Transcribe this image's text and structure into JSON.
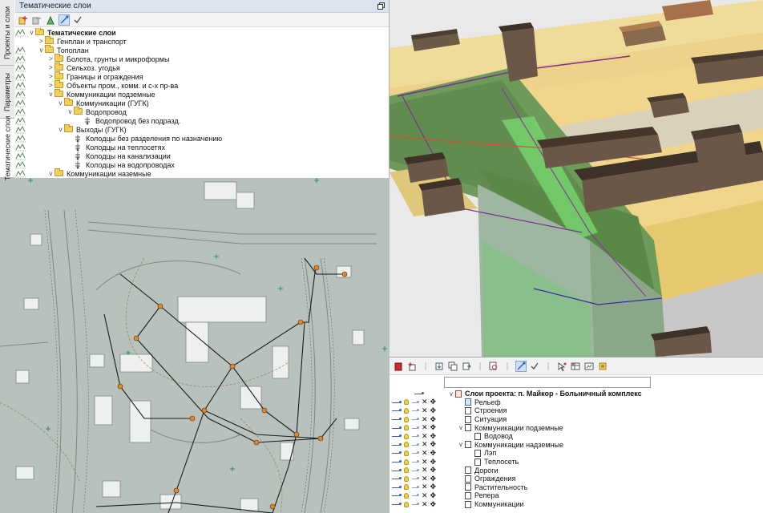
{
  "thematic_panel": {
    "title": "Тематические слои",
    "side_tabs": [
      "Проекты и слои",
      "Параметры",
      "Тематические слои"
    ],
    "tree": [
      {
        "label": "Тематические слои",
        "depth": 0,
        "expander": "v",
        "bold": true,
        "icon": "folder-icon",
        "marks": true
      },
      {
        "label": "Генплан и транспорт",
        "depth": 1,
        "expander": ">",
        "icon": "folder-icon",
        "marks": false
      },
      {
        "label": "Топоплан",
        "depth": 1,
        "expander": "v",
        "icon": "folder-icon",
        "marks": true
      },
      {
        "label": "Болота, грунты и микроформы",
        "depth": 2,
        "expander": ">",
        "icon": "folder-icon",
        "marks": true
      },
      {
        "label": "Сельхоз. угодья",
        "depth": 2,
        "expander": ">",
        "icon": "folder-icon",
        "marks": true
      },
      {
        "label": "Границы и ограждения",
        "depth": 2,
        "expander": ">",
        "icon": "folder-icon",
        "marks": true
      },
      {
        "label": "Объекты пром., комм. и с-х пр-ва",
        "depth": 2,
        "expander": ">",
        "icon": "folder-icon",
        "marks": true
      },
      {
        "label": "Коммуникации подземные",
        "depth": 2,
        "expander": "v",
        "icon": "folder-icon",
        "marks": true
      },
      {
        "label": "Коммуникации (ГУГК)",
        "depth": 3,
        "expander": "v",
        "icon": "folder-icon",
        "marks": true
      },
      {
        "label": "Водопровод",
        "depth": 4,
        "expander": "v",
        "icon": "folder-icon",
        "marks": true
      },
      {
        "label": "Водопровод без подразд.",
        "depth": 5,
        "expander": "",
        "icon": "layer-icon",
        "marks": true
      },
      {
        "label": "Выходы (ГУГК)",
        "depth": 3,
        "expander": "v",
        "icon": "folder-icon",
        "marks": true
      },
      {
        "label": "Колодцы без разделения по назначению",
        "depth": 4,
        "expander": "",
        "icon": "layer-icon",
        "marks": true
      },
      {
        "label": "Колодцы на теплосетях",
        "depth": 4,
        "expander": "",
        "icon": "layer-icon",
        "marks": true
      },
      {
        "label": "Колодцы  на канализации",
        "depth": 4,
        "expander": "",
        "icon": "layer-icon",
        "marks": true
      },
      {
        "label": "Колодцы на водопроводах",
        "depth": 4,
        "expander": "",
        "icon": "layer-icon",
        "marks": true
      },
      {
        "label": "Коммуникации наземные",
        "depth": 2,
        "expander": "v",
        "icon": "folder-icon",
        "marks": true
      }
    ]
  },
  "project_panel": {
    "search_value": "",
    "tree": [
      {
        "label": "Слои проекта: п. Майкор - Больничный комплекс",
        "depth": 0,
        "expander": "v",
        "bold": true,
        "icon": "proj",
        "controls": false
      },
      {
        "label": "Рельеф",
        "depth": 1,
        "expander": "",
        "icon": "blue",
        "controls": true
      },
      {
        "label": "Строения",
        "depth": 1,
        "expander": "",
        "icon": "doc",
        "controls": true
      },
      {
        "label": "Ситуация",
        "depth": 1,
        "expander": "",
        "icon": "doc",
        "controls": true
      },
      {
        "label": "Коммуникации подземные",
        "depth": 1,
        "expander": "v",
        "icon": "doc",
        "controls": true
      },
      {
        "label": "Водовод",
        "depth": 2,
        "expander": "",
        "icon": "doc",
        "controls": true
      },
      {
        "label": "Коммуникации надземные",
        "depth": 1,
        "expander": "v",
        "icon": "doc",
        "controls": true
      },
      {
        "label": "Лэп",
        "depth": 2,
        "expander": "",
        "icon": "doc",
        "controls": true
      },
      {
        "label": "Теплосеть",
        "depth": 2,
        "expander": "",
        "icon": "doc",
        "controls": true
      },
      {
        "label": "Дороги",
        "depth": 1,
        "expander": "",
        "icon": "doc",
        "controls": true
      },
      {
        "label": "Ограждения",
        "depth": 1,
        "expander": "",
        "icon": "doc",
        "controls": true
      },
      {
        "label": "Растительность",
        "depth": 1,
        "expander": "",
        "icon": "doc",
        "controls": true
      },
      {
        "label": "Репера",
        "depth": 1,
        "expander": "",
        "icon": "doc",
        "controls": true
      },
      {
        "label": "Коммуникации",
        "depth": 1,
        "expander": "",
        "icon": "doc",
        "controls": true
      }
    ]
  },
  "colors": {
    "terrain_green": "#6e9a5a",
    "terrain_sand": "#f1d58a",
    "roof": "#5b4a3c",
    "plan_bg": "#b9c1bd",
    "utility_node": "#e0872a"
  }
}
